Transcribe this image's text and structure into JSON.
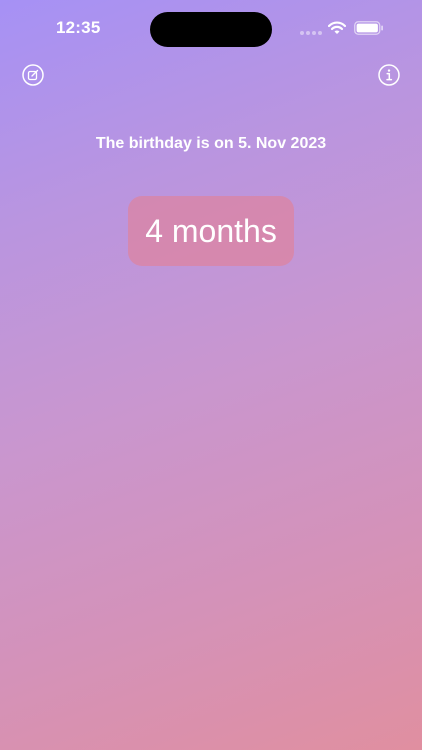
{
  "status_bar": {
    "time": "12:35"
  },
  "toolbar": {
    "left_icon": "edit-icon",
    "right_icon": "info-icon"
  },
  "main": {
    "birthday_label": "The birthday is on 5. Nov 2023",
    "countdown": "4 months"
  },
  "colors": {
    "gradient_start": "#a691f5",
    "gradient_end": "#e08fa0",
    "card_background": "#e77e8c",
    "text": "#ffffff"
  }
}
